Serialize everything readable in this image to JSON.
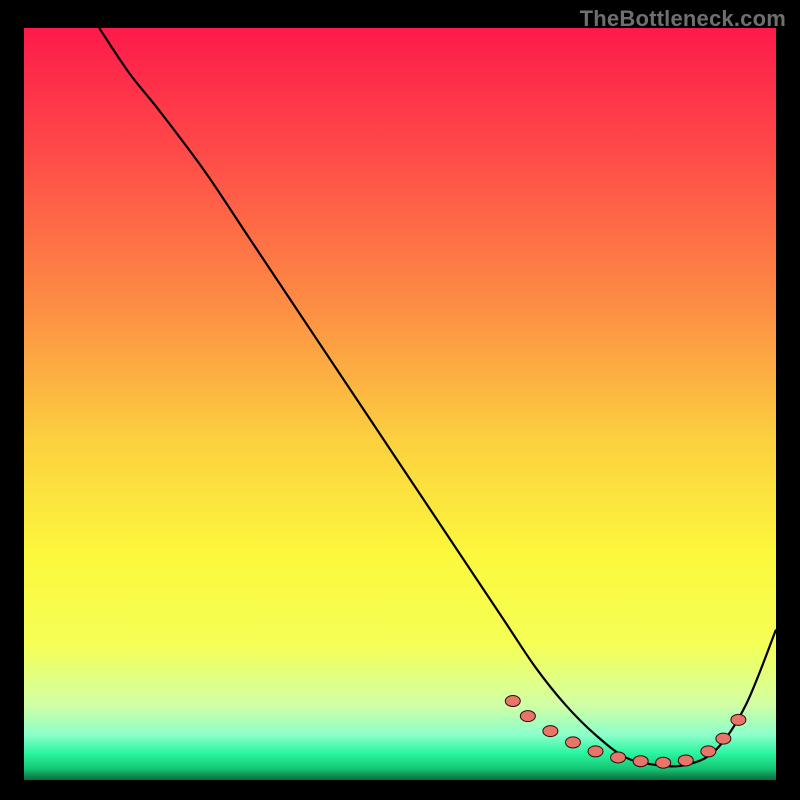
{
  "watermark": "TheBottleneck.com",
  "colors": {
    "frame": "#000000",
    "curve": "#000000",
    "marker_fill": "#e9746a",
    "marker_stroke": "#2b0c0c",
    "gradient_stops": [
      {
        "offset": 0.0,
        "color": "#fd1a4a"
      },
      {
        "offset": 0.18,
        "color": "#fe4f48"
      },
      {
        "offset": 0.38,
        "color": "#fd9144"
      },
      {
        "offset": 0.55,
        "color": "#fcd13f"
      },
      {
        "offset": 0.7,
        "color": "#fcf83c"
      },
      {
        "offset": 0.82,
        "color": "#f5ff56"
      },
      {
        "offset": 0.9,
        "color": "#d2ffa5"
      },
      {
        "offset": 0.94,
        "color": "#8bffca"
      },
      {
        "offset": 0.965,
        "color": "#28f59e"
      },
      {
        "offset": 0.985,
        "color": "#16c574"
      },
      {
        "offset": 1.0,
        "color": "#0a6b3f"
      }
    ]
  },
  "chart_data": {
    "type": "line",
    "title": "",
    "xlabel": "",
    "ylabel": "",
    "xlim": [
      0,
      100
    ],
    "ylim": [
      0,
      100
    ],
    "grid": false,
    "legend": false,
    "series": [
      {
        "name": "curve",
        "x": [
          10,
          14,
          18,
          24,
          30,
          38,
          46,
          54,
          60,
          64,
          68,
          72,
          76,
          80,
          84,
          88,
          92,
          96,
          100
        ],
        "y": [
          100,
          94,
          89,
          81,
          72,
          60,
          48,
          36,
          27,
          21,
          15,
          10,
          6,
          3,
          2,
          2,
          4,
          10,
          20
        ]
      }
    ],
    "markers": {
      "name": "cluster",
      "points": [
        {
          "x": 65,
          "y": 10.5
        },
        {
          "x": 67,
          "y": 8.5
        },
        {
          "x": 70,
          "y": 6.5
        },
        {
          "x": 73,
          "y": 5.0
        },
        {
          "x": 76,
          "y": 3.8
        },
        {
          "x": 79,
          "y": 3.0
        },
        {
          "x": 82,
          "y": 2.5
        },
        {
          "x": 85,
          "y": 2.3
        },
        {
          "x": 88,
          "y": 2.6
        },
        {
          "x": 91,
          "y": 3.8
        },
        {
          "x": 93,
          "y": 5.5
        },
        {
          "x": 95,
          "y": 8.0
        }
      ]
    }
  }
}
